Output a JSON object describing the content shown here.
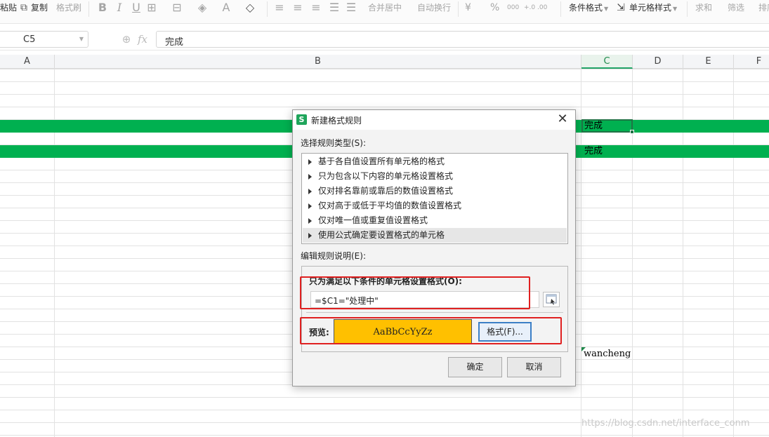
{
  "toolbar": {
    "paste": "粘贴",
    "copy": "复制",
    "format_painter": "格式刷",
    "merge_center": "合并居中",
    "wrap_text": "自动换行",
    "yuan": "¥",
    "percent": "%",
    "thousands": "000",
    "dec_inc": "+.0 .00",
    "dec_dec": "-.0 .00",
    "conditional_format": "条件格式",
    "cell_style": "单元格样式",
    "sum": "求和",
    "filter": "筛选",
    "sort": "排序"
  },
  "formula_bar": {
    "cell_ref": "C5",
    "content": "完成"
  },
  "columns": [
    "A",
    "B",
    "C",
    "D",
    "E",
    "F"
  ],
  "cells": {
    "c5": "完成",
    "c7": "完成",
    "c23": "wancheng"
  },
  "watermark": "https://blog.csdn.net/interface_conm",
  "dialog": {
    "title": "新建格式规则",
    "rule_type_label": "选择规则类型(S):",
    "rule_types": [
      "基于各自值设置所有单元格的格式",
      "只为包含以下内容的单元格设置格式",
      "仅对排名靠前或靠后的数值设置格式",
      "仅对高于或低于平均值的数值设置格式",
      "仅对唯一值或重复值设置格式",
      "使用公式确定要设置格式的单元格"
    ],
    "selected_rule_index": 5,
    "edit_label": "编辑规则说明(E):",
    "condition_label": "只为满足以下条件的单元格设置格式(O):",
    "formula": "=$C1=\"处理中\"",
    "preview_label": "预览:",
    "preview_text": "AaBbCcYyZz",
    "preview_color": "#FFC000",
    "format_button": "格式(F)...",
    "ok_button": "确定",
    "cancel_button": "取消"
  },
  "colors": {
    "highlight_row": "#00B050",
    "annotation_red": "#E02020",
    "selected_col_header": "#217346"
  }
}
